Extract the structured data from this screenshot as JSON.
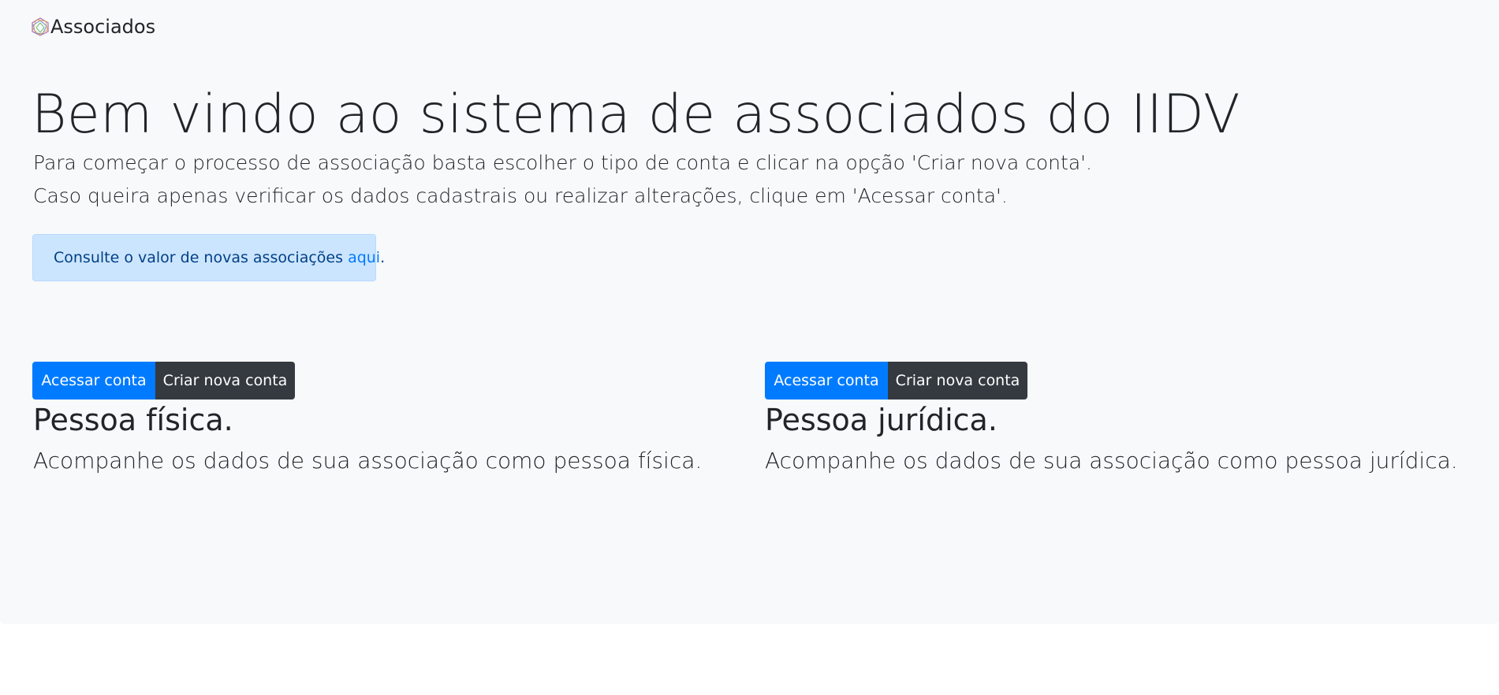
{
  "navbar": {
    "brand_text": "Associados",
    "logo_icon": "iidv-logo-icon"
  },
  "hero": {
    "title": "Bem vindo ao sistema de associados do IIDV",
    "lead_1": "Para começar o processo de associação basta escolher o tipo de conta e clicar na opção 'Criar nova conta'.",
    "lead_2": "Caso queira apenas verificar os dados cadastrais ou realizar alterações, clique em 'Acessar conta'."
  },
  "alert": {
    "text": "Consulte o valor de novas associações ",
    "link_text": "aqui",
    "suffix": "."
  },
  "account_types": [
    {
      "access_label": "Acessar conta",
      "create_label": "Criar nova conta",
      "title": "Pessoa física.",
      "description": "Acompanhe os dados de sua associação como pessoa física."
    },
    {
      "access_label": "Acessar conta",
      "create_label": "Criar nova conta",
      "title": "Pessoa jurídica.",
      "description": "Acompanhe os dados de sua associação como pessoa jurídica."
    }
  ],
  "colors": {
    "primary": "#007bff",
    "dark": "#343a40",
    "alert_bg": "#cce5ff",
    "alert_text": "#004085",
    "surface": "#f8f9fa"
  }
}
